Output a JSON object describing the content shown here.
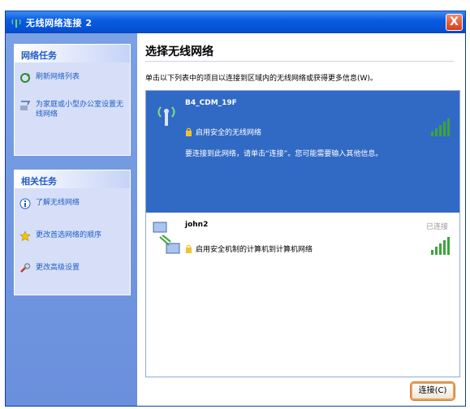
{
  "window": {
    "title": "无线网络连接 2",
    "close_label": "X"
  },
  "sidebar": {
    "network_tasks": {
      "heading": "网络任务",
      "items": [
        {
          "label": "刷新网络列表",
          "icon": "refresh-icon"
        },
        {
          "label": "为家庭或小型办公室设置无线网络",
          "icon": "wizard-icon"
        }
      ]
    },
    "related_tasks": {
      "heading": "相关任务",
      "items": [
        {
          "label": "了解无线网络",
          "icon": "info-icon"
        },
        {
          "label": "更改首选网络的顺序",
          "icon": "star-icon"
        },
        {
          "label": "更改高级设置",
          "icon": "settings-icon"
        }
      ]
    }
  },
  "main": {
    "heading": "选择无线网络",
    "instruction": "单击以下列表中的项目以连接到区域内的无线网络或获得更多信息(W)。",
    "networks": [
      {
        "ssid": "B4_CDM_19F",
        "security": "启用安全的无线网络",
        "hint": "要连接到此网络，请单击“连接”。您可能需要输入其他信息。",
        "signal": 5,
        "selected": true
      },
      {
        "ssid": "john2",
        "security": "启用安全机制的计算机到计算机网络",
        "status": "已连接",
        "signal": 5,
        "selected": false
      }
    ],
    "connect_label": "连接(C)"
  },
  "colors": {
    "titlebar": "#0551d6",
    "sidebar_bg": "#6a8fdc",
    "selected_row": "#316ac5",
    "signal_green": "#3aa53a"
  }
}
